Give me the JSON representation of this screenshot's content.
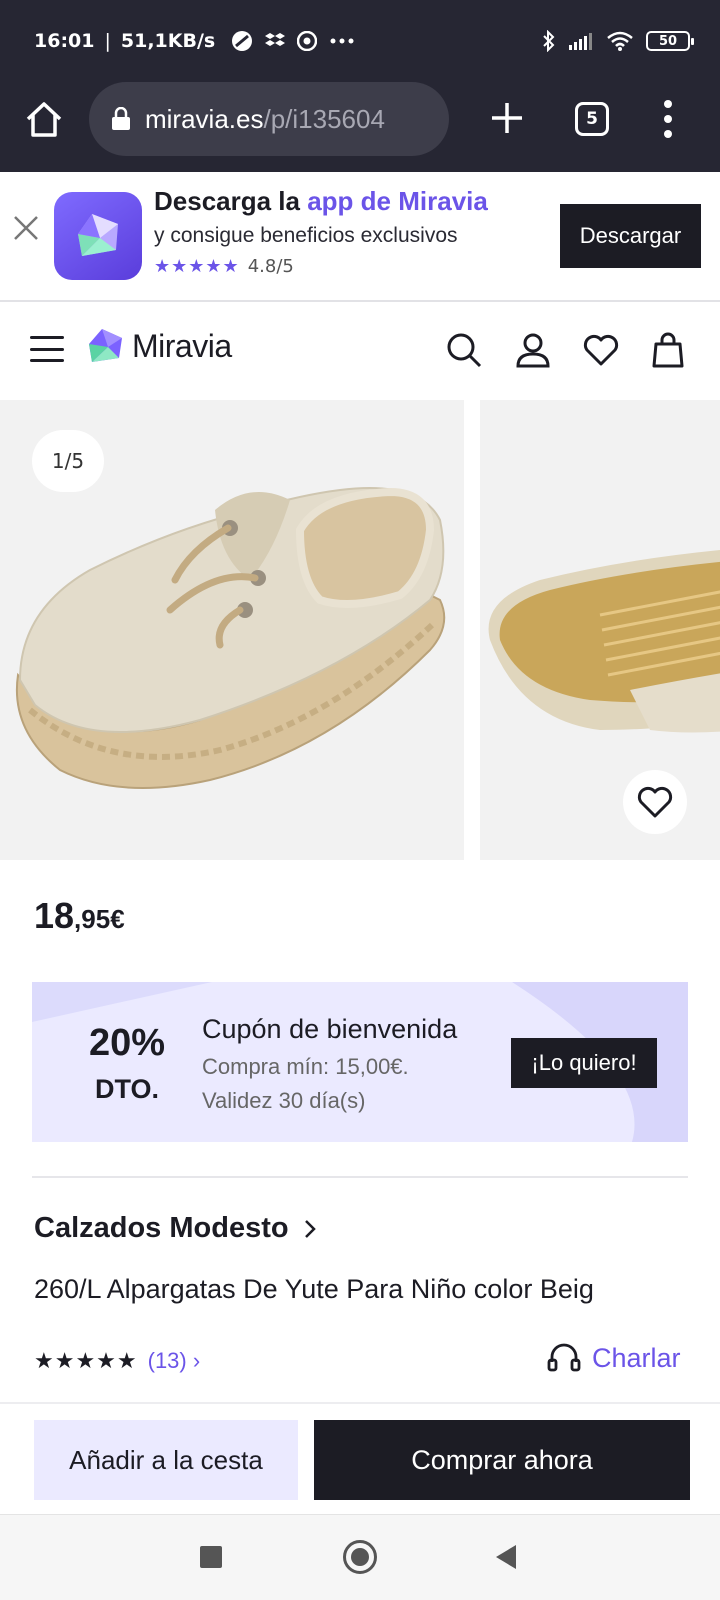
{
  "status_bar": {
    "time": "16:01",
    "net_speed": "51,1KB/s",
    "battery": "50",
    "icons": [
      "vpn-icon",
      "dropbox-icon",
      "chrome-icon",
      "more-dots-icon",
      "bluetooth-icon",
      "signal-icon",
      "wifi-icon",
      "battery-icon"
    ]
  },
  "browser": {
    "url_host": "miravia.es",
    "url_path": "/p/i135604",
    "tab_count": "5"
  },
  "app_banner": {
    "title_plain": "Descarga la ",
    "title_accent": "app de Miravia",
    "subtitle": "y consigue beneficios exclusivos",
    "stars": "★★★★★",
    "rating": "4.8/5",
    "button": "Descargar"
  },
  "header": {
    "logo_text": "Miravia"
  },
  "gallery": {
    "counter": "1/5"
  },
  "product": {
    "price_int": "18",
    "price_dec": ",95€",
    "seller": "Calzados Modesto",
    "title": "260/L Alpargatas De Yute Para Niño color Beig",
    "stars": "★★★★★",
    "review_count": "(13) ›",
    "rating_value": 5
  },
  "coupon": {
    "percent": "20%",
    "dto": "DTO.",
    "title": "Cupón de bienvenida",
    "min_purchase": "Compra mín: 15,00€.",
    "validity": "Validez 30 día(s)",
    "button": "¡Lo quiero!"
  },
  "chat": {
    "label": "Charlar"
  },
  "actions": {
    "add_to_cart": "Añadir a la cesta",
    "buy_now": "Comprar ahora"
  },
  "colors": {
    "brand": "#6b54e8",
    "dark": "#1c1c24",
    "chrome": "#262633",
    "coupon_bg": "#ebeaff"
  }
}
